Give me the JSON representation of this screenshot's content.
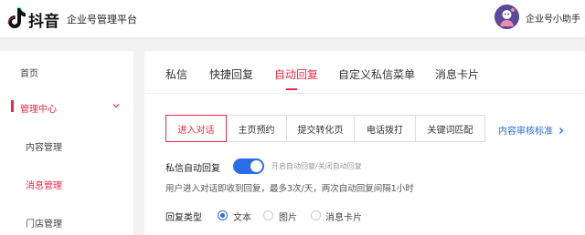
{
  "header": {
    "brand": "抖音",
    "platform": "企业号管理平台",
    "username": "企业号小助手"
  },
  "sidebar": {
    "items": [
      {
        "label": "首页",
        "active": false
      },
      {
        "label": "管理中心",
        "active": true,
        "expanded": true
      },
      {
        "label": "内容管理",
        "active": false
      },
      {
        "label": "消息管理",
        "active": true
      },
      {
        "label": "门店管理",
        "active": false
      }
    ]
  },
  "tabs": [
    {
      "label": "私信",
      "active": false
    },
    {
      "label": "快捷回复",
      "active": false
    },
    {
      "label": "自动回复",
      "active": true
    },
    {
      "label": "自定义私信菜单",
      "active": false
    },
    {
      "label": "消息卡片",
      "active": false
    }
  ],
  "segments": [
    {
      "label": "进入对话",
      "active": true
    },
    {
      "label": "主页预约",
      "active": false
    },
    {
      "label": "提交转化页",
      "active": false
    },
    {
      "label": "电话拨打",
      "active": false
    },
    {
      "label": "关键词匹配",
      "active": false
    }
  ],
  "review_link": "内容审核标准",
  "auto_reply": {
    "label": "私信自动回复",
    "enabled": true,
    "hint": "开启自动回复/关闭自动回复",
    "description": "用户进入对话即收到回复，最多3次/天，两次自动回复间隔1小时"
  },
  "reply_type": {
    "label": "回复类型",
    "options": [
      {
        "label": "文本",
        "checked": true
      },
      {
        "label": "图片",
        "checked": false
      },
      {
        "label": "消息卡片",
        "checked": false
      }
    ]
  },
  "colors": {
    "accent": "#f0284b",
    "primary_blue": "#2d6ce8",
    "link": "#2a6fdb"
  }
}
